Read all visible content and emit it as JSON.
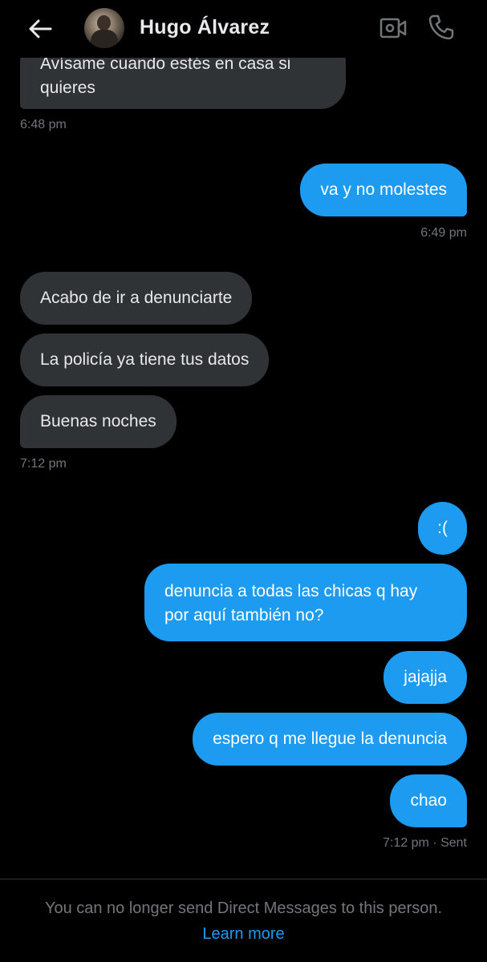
{
  "header": {
    "contact_name": "Hugo Álvarez",
    "back_icon": "arrow-left-icon",
    "video_icon": "video-camera-icon",
    "phone_icon": "phone-icon"
  },
  "messages": [
    {
      "direction": "in",
      "text_line1": "Avísame cuando estés en casa si",
      "text_line2": "quieres",
      "time": "6:48 pm"
    },
    {
      "direction": "out",
      "text": "va y no molestes",
      "time": "6:49 pm"
    },
    {
      "direction": "in",
      "text": "Acabo de ir a denunciarte"
    },
    {
      "direction": "in",
      "text": "La policía ya tiene tus datos"
    },
    {
      "direction": "in",
      "text": "Buenas noches",
      "time": "7:12 pm"
    },
    {
      "direction": "out",
      "text": ":("
    },
    {
      "direction": "out",
      "text_line1": "denuncia a todas las chicas q hay",
      "text_line2": "por aquí también no?"
    },
    {
      "direction": "out",
      "text": "jajajja"
    },
    {
      "direction": "out",
      "text": "espero q me llegue la denuncia"
    },
    {
      "direction": "out",
      "text": "chao",
      "time": "7:12 pm · Sent"
    }
  ],
  "footer": {
    "notice": "You can no longer send Direct Messages to this person.",
    "link": "Learn more"
  },
  "colors": {
    "background": "#000000",
    "incoming_bubble": "#2f3336",
    "outgoing_bubble": "#1d9bf0",
    "accent": "#1d9bf0",
    "muted_text": "#71767b"
  }
}
